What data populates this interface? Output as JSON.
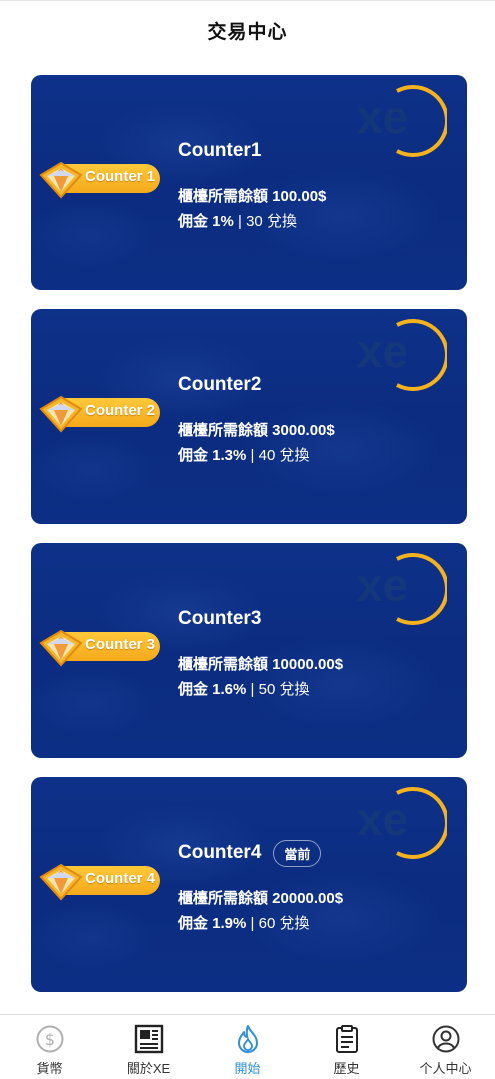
{
  "header": {
    "title": "交易中心"
  },
  "labels": {
    "balance_prefix": "櫃檯所需餘額 ",
    "commission_prefix": "佣金 ",
    "separator": " | ",
    "exchange_suffix": " 兌換",
    "current_tag": "當前"
  },
  "counters": [
    {
      "name": "Counter1",
      "badge": "Counter 1",
      "balance": "100.00$",
      "commission": "1%",
      "exchanges": "30"
    },
    {
      "name": "Counter2",
      "badge": "Counter 2",
      "balance": "3000.00$",
      "commission": "1.3%",
      "exchanges": "40"
    },
    {
      "name": "Counter3",
      "badge": "Counter 3",
      "balance": "10000.00$",
      "commission": "1.6%",
      "exchanges": "50"
    },
    {
      "name": "Counter4",
      "badge": "Counter 4",
      "balance": "20000.00$",
      "commission": "1.9%",
      "exchanges": "60"
    }
  ],
  "tabbar": {
    "items": [
      {
        "label": "貨幣",
        "icon": "dollar-coin-icon"
      },
      {
        "label": "關於XE",
        "icon": "newspaper-icon"
      },
      {
        "label": "開始",
        "icon": "flame-icon"
      },
      {
        "label": "歷史",
        "icon": "clipboard-icon"
      },
      {
        "label": "个人中心",
        "icon": "user-circle-icon"
      }
    ],
    "active_color": "#2d8fd5"
  },
  "colors": {
    "card_bg": "#0c2e84",
    "badge_gold": "#f4a91b",
    "xe_ring": "#f3b21e"
  }
}
